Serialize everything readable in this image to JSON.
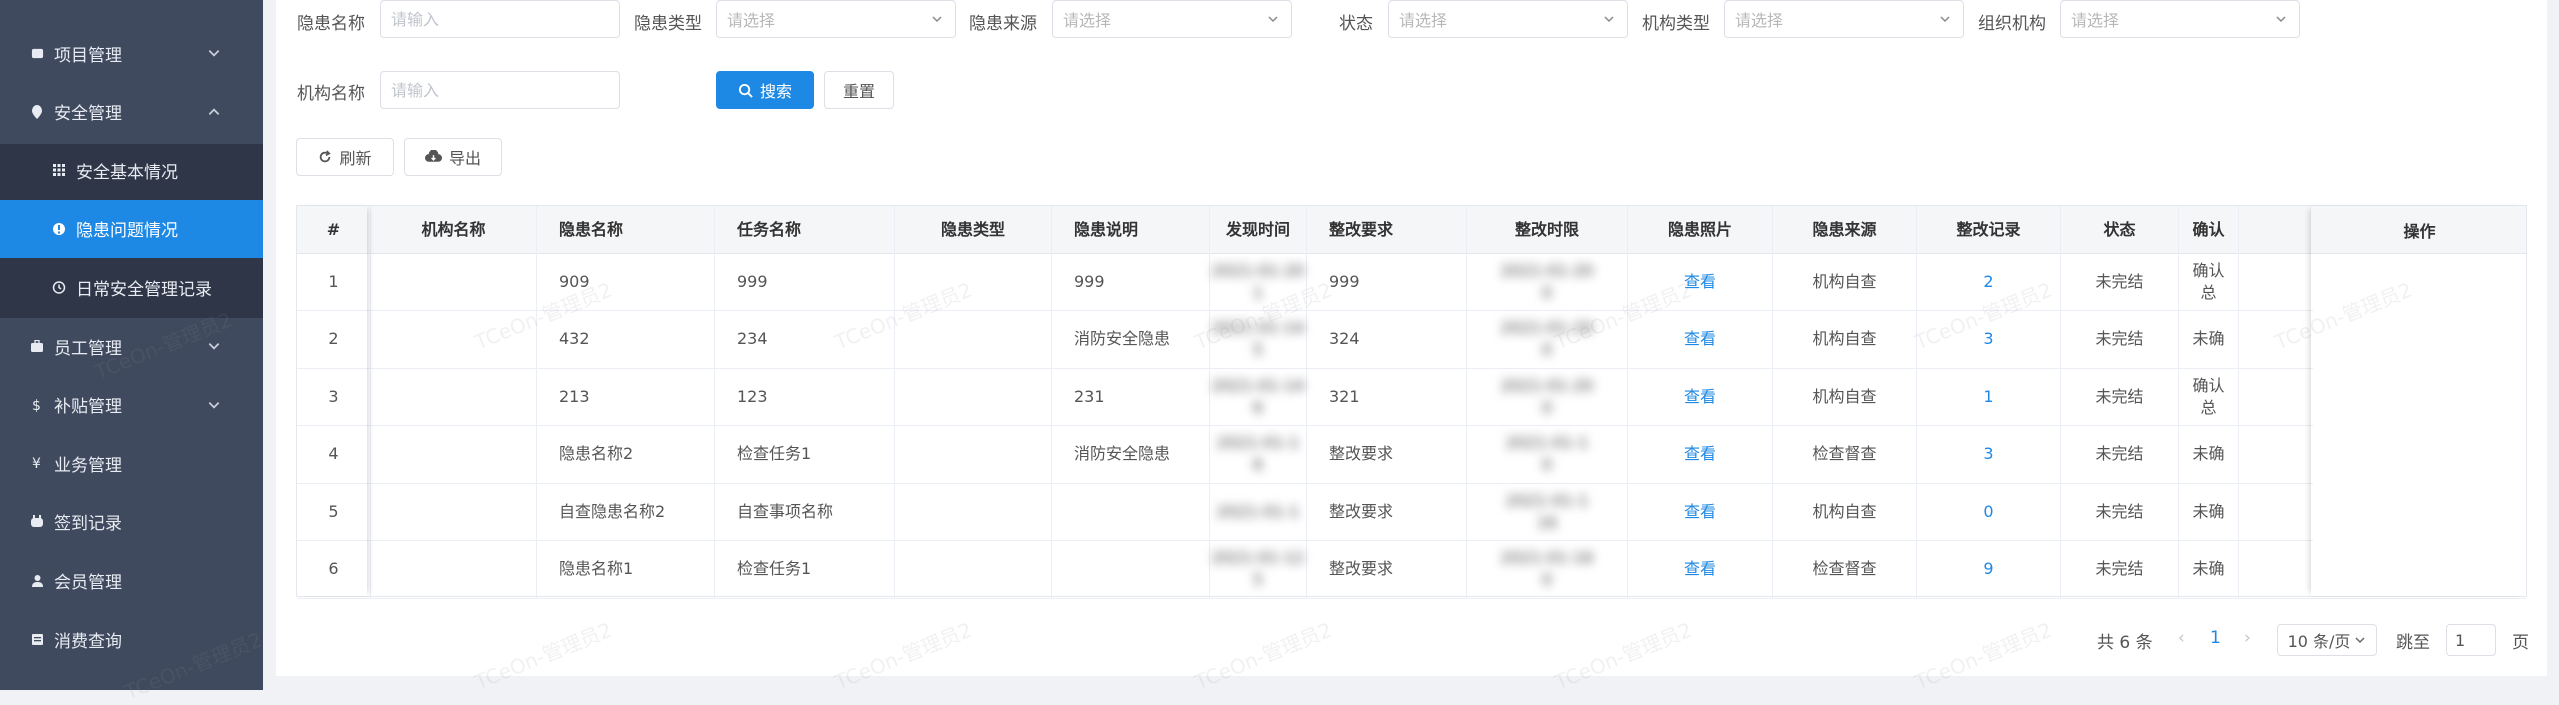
{
  "sidebar": {
    "items": [
      {
        "label": "项目管理",
        "icon": "project-icon",
        "expandable": true
      },
      {
        "label": "安全管理",
        "icon": "shield-icon",
        "expandable": true,
        "expanded": true
      },
      {
        "label": "安全基本情况",
        "icon": "grid-icon",
        "sub": true
      },
      {
        "label": "隐患问题情况",
        "icon": "info-circle-icon",
        "sub": true,
        "active": true
      },
      {
        "label": "日常安全管理记录",
        "icon": "clock-icon",
        "sub": true
      },
      {
        "label": "员工管理",
        "icon": "staff-icon",
        "expandable": true
      },
      {
        "label": "补贴管理",
        "icon": "dollar-icon",
        "expandable": true
      },
      {
        "label": "业务管理",
        "icon": "yen-icon"
      },
      {
        "label": "签到记录",
        "icon": "checkin-icon"
      },
      {
        "label": "会员管理",
        "icon": "user-icon"
      },
      {
        "label": "消费查询",
        "icon": "receipt-icon"
      }
    ]
  },
  "filters": {
    "hazard_name": {
      "label": "隐患名称",
      "placeholder": "请输入"
    },
    "hazard_type": {
      "label": "隐患类型",
      "placeholder": "请选择"
    },
    "hazard_source": {
      "label": "隐患来源",
      "placeholder": "请选择"
    },
    "status": {
      "label": "状态",
      "placeholder": "请选择"
    },
    "org_type": {
      "label": "机构类型",
      "placeholder": "请选择"
    },
    "org": {
      "label": "组织机构",
      "placeholder": "请选择"
    },
    "org_name": {
      "label": "机构名称",
      "placeholder": "请输入"
    },
    "search_label": "搜索",
    "reset_label": "重置"
  },
  "toolbar": {
    "refresh_label": "刷新",
    "export_label": "导出"
  },
  "table": {
    "headers": [
      "#",
      "机构名称",
      "隐患名称",
      "任务名称",
      "隐患类型",
      "隐患说明",
      "发现时间",
      "整改要求",
      "整改时限",
      "隐患照片",
      "隐患来源",
      "整改记录",
      "状态",
      "确认",
      "操作"
    ],
    "rows": [
      {
        "index": "1",
        "org": "",
        "name": "909",
        "task": "999",
        "type": "",
        "desc": "999",
        "found_1": "2021-01-20",
        "found_2": "1",
        "req": "999",
        "limit_1": "2021-01-20",
        "limit_2": "0",
        "photo": "查看",
        "source": "机构自查",
        "records": "2",
        "status": "未完结",
        "confirm_1": "确认",
        "confirm_2": "总"
      },
      {
        "index": "2",
        "org": "",
        "name": "432",
        "task": "234",
        "type": "",
        "desc": "消防安全隐患",
        "found_1": "2021-01-14",
        "found_2": "5",
        "req": "324",
        "limit_1": "2021-01-20",
        "limit_2": "0",
        "photo": "查看",
        "source": "机构自查",
        "records": "3",
        "status": "未完结",
        "confirm_1": "未确",
        "confirm_2": ""
      },
      {
        "index": "3",
        "org": "",
        "name": "213",
        "task": "123",
        "type": "",
        "desc": "231",
        "found_1": "2021-01-14",
        "found_2": "6",
        "req": "321",
        "limit_1": "2021-01-20",
        "limit_2": "0",
        "photo": "查看",
        "source": "机构自查",
        "records": "1",
        "status": "未完结",
        "confirm_1": "确认",
        "confirm_2": "总"
      },
      {
        "index": "4",
        "org": "",
        "name": "隐患名称2",
        "task": "检查任务1",
        "type": "",
        "desc": "消防安全隐患",
        "found_1": "2021-01-1",
        "found_2": "6",
        "req": "整改要求",
        "limit_1": "2021-01-1",
        "limit_2": "0",
        "photo": "查看",
        "source": "检查督查",
        "records": "3",
        "status": "未完结",
        "confirm_1": "未确",
        "confirm_2": ""
      },
      {
        "index": "5",
        "org": "",
        "name": "自查隐患名称2",
        "task": "自查事项名称",
        "type": "",
        "desc": "",
        "found_1": "2021-01-1",
        "found_2": "",
        "req": "整改要求",
        "limit_1": "2021-01-1",
        "limit_2": "16",
        "photo": "查看",
        "source": "机构自查",
        "records": "0",
        "status": "未完结",
        "confirm_1": "未确",
        "confirm_2": ""
      },
      {
        "index": "6",
        "org": "",
        "name": "隐患名称1",
        "task": "检查任务1",
        "type": "",
        "desc": "",
        "found_1": "2021-01-12",
        "found_2": "5",
        "req": "整改要求",
        "limit_1": "2021-01-16",
        "limit_2": "0",
        "photo": "查看",
        "source": "检查督查",
        "records": "9",
        "status": "未完结",
        "confirm_1": "未确",
        "confirm_2": ""
      }
    ]
  },
  "pagination": {
    "total": "共 6 条",
    "prev": "‹",
    "page": "1",
    "next": "›",
    "page_size": "10 条/页",
    "jump_label": "跳至",
    "jump_value": "1",
    "page_unit": "页"
  },
  "watermark": "TCeOn-管理员2",
  "colors": {
    "sidebar": "#3f4a5e",
    "sidebar_sub": "#2e3647",
    "accent": "#1e88e5"
  }
}
